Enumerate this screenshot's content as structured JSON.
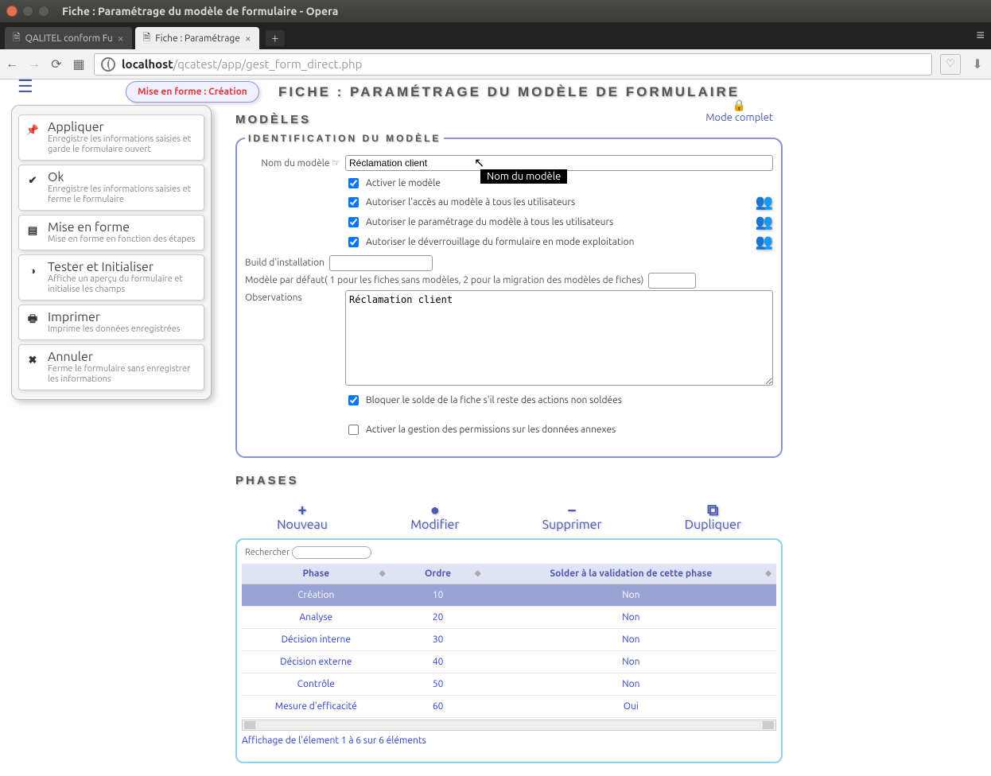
{
  "os": {
    "window_title": "Fiche : Paramétrage du modèle de formulaire - Opera"
  },
  "browser": {
    "tabs": [
      {
        "label": "QALITEL conform Fu"
      },
      {
        "label": "Fiche : Paramétrage"
      }
    ],
    "url_host": "localhost",
    "url_path": "/qcatest/app/gest_form_direct.php"
  },
  "mode_badge": "Mise en forme : Création",
  "page_title": "FICHE : PARAMÉTRAGE DU MODÈLE DE FORMULAIRE",
  "mode_complet": "Mode complet",
  "sidebar": {
    "items": [
      {
        "title": "Appliquer",
        "desc": "Enregistre les informations saisies et garde le formulaire ouvert",
        "icon": "pin-icon"
      },
      {
        "title": "Ok",
        "desc": "Enregistre les informations saisies et ferme le formulaire",
        "icon": "check-icon"
      },
      {
        "title": "Mise en forme",
        "desc": "Mise en forme en fonction des étapes",
        "icon": "grid-icon"
      },
      {
        "title": "Tester et Initialiser",
        "desc": "Affiche un aperçu du formulaire et initialise les champs",
        "icon": "gear-icon"
      },
      {
        "title": "Imprimer",
        "desc": "Imprime les données enregistrées",
        "icon": "print-icon"
      },
      {
        "title": "Annuler",
        "desc": "Ferme le formulaire sans enregistrer les informations",
        "icon": "close-icon"
      }
    ]
  },
  "section_modeles": "MODÈLES",
  "fieldset_id": "IDENTIFICATION DU MODÈLE",
  "form": {
    "label_nom": "Nom du modèle",
    "nom_value": "Réclamation client",
    "tooltip_nom": "Nom du modèle",
    "chk_activer": "Activer le modèle",
    "chk_acces": "Autoriser l'accès au modèle à tous les utilisateurs",
    "chk_param": "Autoriser le paramétrage du modèle à tous les utilisateurs",
    "chk_unlock": "Autoriser le déverrouillage du formulaire en mode exploitation",
    "label_build": "Build d'installation",
    "build_value": "",
    "label_defaut": "Modèle par défaut( 1 pour les fiches sans modèles, 2 pour la migration des modèles de fiches)",
    "defaut_value": "",
    "label_obs": "Observations",
    "obs_value": "Réclamation client",
    "chk_bloquer": "Bloquer le solde de la fiche s'il reste des actions non soldées",
    "chk_perms": "Activer la gestion des permissions sur les données annexes"
  },
  "section_phases": "PHASES",
  "actions": {
    "nouveau": "Nouveau",
    "modifier": "Modifier",
    "supprimer": "Supprimer",
    "dupliquer": "Dupliquer"
  },
  "phases": {
    "search_label": "Rechercher",
    "search_value": "",
    "headers": {
      "phase": "Phase",
      "ordre": "Ordre",
      "solder": "Solder à la validation de cette phase"
    },
    "rows": [
      {
        "phase": "Création",
        "ordre": "10",
        "solder": "Non"
      },
      {
        "phase": "Analyse",
        "ordre": "20",
        "solder": "Non"
      },
      {
        "phase": "Décision interne",
        "ordre": "30",
        "solder": "Non"
      },
      {
        "phase": "Décision externe",
        "ordre": "40",
        "solder": "Non"
      },
      {
        "phase": "Contrôle",
        "ordre": "50",
        "solder": "Non"
      },
      {
        "phase": "Mesure d'efficacité",
        "ordre": "60",
        "solder": "Oui"
      }
    ],
    "footer": "Affichage de l'élement 1 à 6 sur 6 éléments"
  }
}
